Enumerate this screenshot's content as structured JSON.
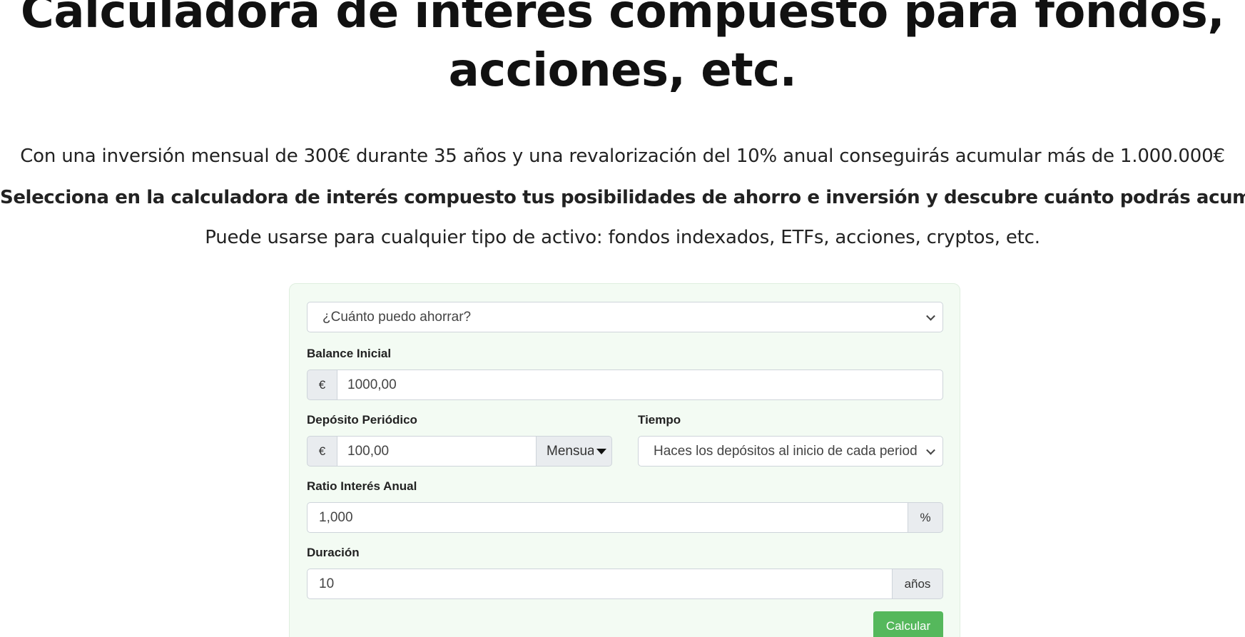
{
  "page": {
    "title": "Calculadora de interés compuesto para fondos, acciones, etc.",
    "intro": "Con una inversión mensual de 300€ durante 35 años y una revalorización del 10% anual conseguirás acumular más de 1.000.000€",
    "cta": "Selecciona en la calculadora de interés compuesto tus posibilidades de ahorro e inversión y descubre cuánto podrás acumular.",
    "scope": "Puede usarse para cualquier tipo de activo: fondos indexados, ETFs, acciones, cryptos, etc."
  },
  "calculator": {
    "mode_select": {
      "value": "¿Cuánto puedo ahorrar?",
      "icon": "chevron-down-icon"
    },
    "initial_balance": {
      "label": "Balance Inicial",
      "prefix": "€",
      "value": "1000,00"
    },
    "periodic_deposit": {
      "label": "Depósito Periódico",
      "prefix": "€",
      "value": "100,00",
      "frequency": "Mensual"
    },
    "timing": {
      "label": "Tiempo",
      "value": "Haces los depósitos al inicio de cada periodo"
    },
    "annual_rate": {
      "label": "Ratio Interés Anual",
      "value": "1,000",
      "suffix": "%"
    },
    "duration": {
      "label": "Duración",
      "value": "10",
      "suffix": "años"
    },
    "submit_label": "Calcular"
  },
  "colors": {
    "card_bg": "#f3fbf3",
    "button": "#55b85c",
    "addon_bg": "#e9ecef"
  }
}
